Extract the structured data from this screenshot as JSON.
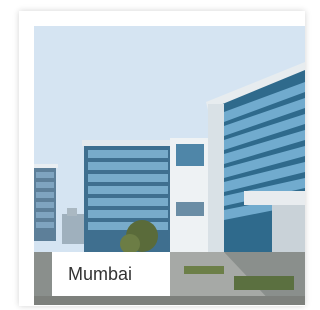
{
  "card": {
    "city_label": "Mumbai",
    "image_icon": "office-building-photo"
  }
}
